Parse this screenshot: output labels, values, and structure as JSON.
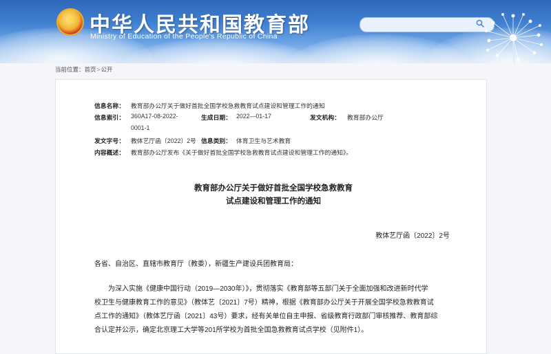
{
  "header": {
    "title_cn": "中华人民共和国教育部",
    "title_en": "Ministry of Education of the People's Republic of China",
    "search_placeholder": ""
  },
  "breadcrumb": {
    "label": "当前位置：",
    "items": [
      "首页",
      "公开"
    ],
    "separator": ">"
  },
  "meta": {
    "info_name_label": "信息名称：",
    "info_name": "教育部办公厅关于做好首批全国学校急救教育试点建设和管理工作的通知",
    "info_index_label": "信息索引：",
    "info_index_line1": "360A17-08-2022-",
    "info_index_line2": "0001-1",
    "gen_date_label": "生成日期：",
    "gen_date": "2022—01-17",
    "issuer_label": "发文机构：",
    "issuer": "教育部办公厅",
    "doc_no_label": "发文字号：",
    "doc_no": "教体艺厅函〔2022〕2号",
    "category_label": "信息类别：",
    "category": "体育卫生与艺术教育",
    "summary_label": "内容概述：",
    "summary": "教育部办公厅发布《关于做好首批全国学校急救教育试点建设和管理工作的通知》。"
  },
  "document": {
    "title_line1": "教育部办公厅关于做好首批全国学校急救教育",
    "title_line2": "试点建设和管理工作的通知",
    "doc_number": "教体艺厅函〔2022〕2号",
    "salutation": "各省、自治区、直辖市教育厅（教委），新疆生产建设兵团教育局：",
    "paragraph_lines": [
      "　　为深入实施《健康中国行动（2019—2030年）》，贯彻落实《教育部等五部门关于全面加强和改进新时代学",
      "校卫生与健康教育工作的意见》（教体艺〔2021〕7号）精神，根据《教育部办公厅关于开展全国学校急救教育试",
      "点工作的通知》（教体艺厅函〔2021〕43号）要求，经有关单位自主申报、省级教育行政部门审核推荐、教育部综",
      "合认定并公示，确定北京理工大学等201所学校为首批全国急救教育试点学校（见附件1）。"
    ]
  },
  "colors": {
    "header_top": "#2f67b8",
    "header_bottom": "#bcd6f2",
    "title_text": "#ffffff",
    "body_text": "#222222"
  }
}
